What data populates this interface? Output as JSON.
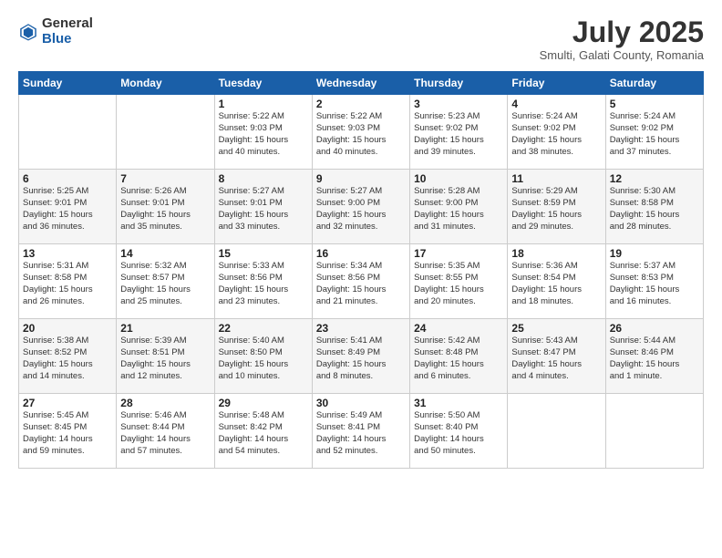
{
  "logo": {
    "general": "General",
    "blue": "Blue"
  },
  "title": "July 2025",
  "subtitle": "Smulti, Galati County, Romania",
  "headers": [
    "Sunday",
    "Monday",
    "Tuesday",
    "Wednesday",
    "Thursday",
    "Friday",
    "Saturday"
  ],
  "weeks": [
    [
      {
        "day": "",
        "info": ""
      },
      {
        "day": "",
        "info": ""
      },
      {
        "day": "1",
        "info": "Sunrise: 5:22 AM\nSunset: 9:03 PM\nDaylight: 15 hours\nand 40 minutes."
      },
      {
        "day": "2",
        "info": "Sunrise: 5:22 AM\nSunset: 9:03 PM\nDaylight: 15 hours\nand 40 minutes."
      },
      {
        "day": "3",
        "info": "Sunrise: 5:23 AM\nSunset: 9:02 PM\nDaylight: 15 hours\nand 39 minutes."
      },
      {
        "day": "4",
        "info": "Sunrise: 5:24 AM\nSunset: 9:02 PM\nDaylight: 15 hours\nand 38 minutes."
      },
      {
        "day": "5",
        "info": "Sunrise: 5:24 AM\nSunset: 9:02 PM\nDaylight: 15 hours\nand 37 minutes."
      }
    ],
    [
      {
        "day": "6",
        "info": "Sunrise: 5:25 AM\nSunset: 9:01 PM\nDaylight: 15 hours\nand 36 minutes."
      },
      {
        "day": "7",
        "info": "Sunrise: 5:26 AM\nSunset: 9:01 PM\nDaylight: 15 hours\nand 35 minutes."
      },
      {
        "day": "8",
        "info": "Sunrise: 5:27 AM\nSunset: 9:01 PM\nDaylight: 15 hours\nand 33 minutes."
      },
      {
        "day": "9",
        "info": "Sunrise: 5:27 AM\nSunset: 9:00 PM\nDaylight: 15 hours\nand 32 minutes."
      },
      {
        "day": "10",
        "info": "Sunrise: 5:28 AM\nSunset: 9:00 PM\nDaylight: 15 hours\nand 31 minutes."
      },
      {
        "day": "11",
        "info": "Sunrise: 5:29 AM\nSunset: 8:59 PM\nDaylight: 15 hours\nand 29 minutes."
      },
      {
        "day": "12",
        "info": "Sunrise: 5:30 AM\nSunset: 8:58 PM\nDaylight: 15 hours\nand 28 minutes."
      }
    ],
    [
      {
        "day": "13",
        "info": "Sunrise: 5:31 AM\nSunset: 8:58 PM\nDaylight: 15 hours\nand 26 minutes."
      },
      {
        "day": "14",
        "info": "Sunrise: 5:32 AM\nSunset: 8:57 PM\nDaylight: 15 hours\nand 25 minutes."
      },
      {
        "day": "15",
        "info": "Sunrise: 5:33 AM\nSunset: 8:56 PM\nDaylight: 15 hours\nand 23 minutes."
      },
      {
        "day": "16",
        "info": "Sunrise: 5:34 AM\nSunset: 8:56 PM\nDaylight: 15 hours\nand 21 minutes."
      },
      {
        "day": "17",
        "info": "Sunrise: 5:35 AM\nSunset: 8:55 PM\nDaylight: 15 hours\nand 20 minutes."
      },
      {
        "day": "18",
        "info": "Sunrise: 5:36 AM\nSunset: 8:54 PM\nDaylight: 15 hours\nand 18 minutes."
      },
      {
        "day": "19",
        "info": "Sunrise: 5:37 AM\nSunset: 8:53 PM\nDaylight: 15 hours\nand 16 minutes."
      }
    ],
    [
      {
        "day": "20",
        "info": "Sunrise: 5:38 AM\nSunset: 8:52 PM\nDaylight: 15 hours\nand 14 minutes."
      },
      {
        "day": "21",
        "info": "Sunrise: 5:39 AM\nSunset: 8:51 PM\nDaylight: 15 hours\nand 12 minutes."
      },
      {
        "day": "22",
        "info": "Sunrise: 5:40 AM\nSunset: 8:50 PM\nDaylight: 15 hours\nand 10 minutes."
      },
      {
        "day": "23",
        "info": "Sunrise: 5:41 AM\nSunset: 8:49 PM\nDaylight: 15 hours\nand 8 minutes."
      },
      {
        "day": "24",
        "info": "Sunrise: 5:42 AM\nSunset: 8:48 PM\nDaylight: 15 hours\nand 6 minutes."
      },
      {
        "day": "25",
        "info": "Sunrise: 5:43 AM\nSunset: 8:47 PM\nDaylight: 15 hours\nand 4 minutes."
      },
      {
        "day": "26",
        "info": "Sunrise: 5:44 AM\nSunset: 8:46 PM\nDaylight: 15 hours\nand 1 minute."
      }
    ],
    [
      {
        "day": "27",
        "info": "Sunrise: 5:45 AM\nSunset: 8:45 PM\nDaylight: 14 hours\nand 59 minutes."
      },
      {
        "day": "28",
        "info": "Sunrise: 5:46 AM\nSunset: 8:44 PM\nDaylight: 14 hours\nand 57 minutes."
      },
      {
        "day": "29",
        "info": "Sunrise: 5:48 AM\nSunset: 8:42 PM\nDaylight: 14 hours\nand 54 minutes."
      },
      {
        "day": "30",
        "info": "Sunrise: 5:49 AM\nSunset: 8:41 PM\nDaylight: 14 hours\nand 52 minutes."
      },
      {
        "day": "31",
        "info": "Sunrise: 5:50 AM\nSunset: 8:40 PM\nDaylight: 14 hours\nand 50 minutes."
      },
      {
        "day": "",
        "info": ""
      },
      {
        "day": "",
        "info": ""
      }
    ]
  ]
}
